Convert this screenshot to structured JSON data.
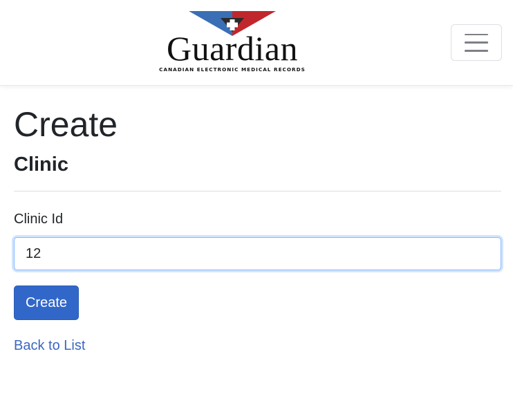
{
  "header": {
    "logo": {
      "wordmark": "Guardian",
      "tagline": "CANADIAN ELECTRONIC MEDICAL RECORDS",
      "colors": {
        "blue": "#3a6fb5",
        "red": "#c0272d",
        "dark": "#2a2a2a"
      }
    },
    "menu_icon": "hamburger-icon"
  },
  "page": {
    "title": "Create",
    "subtitle": "Clinic"
  },
  "form": {
    "clinic_id_label": "Clinic Id",
    "clinic_id_value": "12",
    "submit_label": "Create"
  },
  "links": {
    "back_label": "Back to List"
  },
  "colors": {
    "primary": "#3167c8",
    "link": "#3a67c2",
    "focus_border": "#86b7fe"
  }
}
